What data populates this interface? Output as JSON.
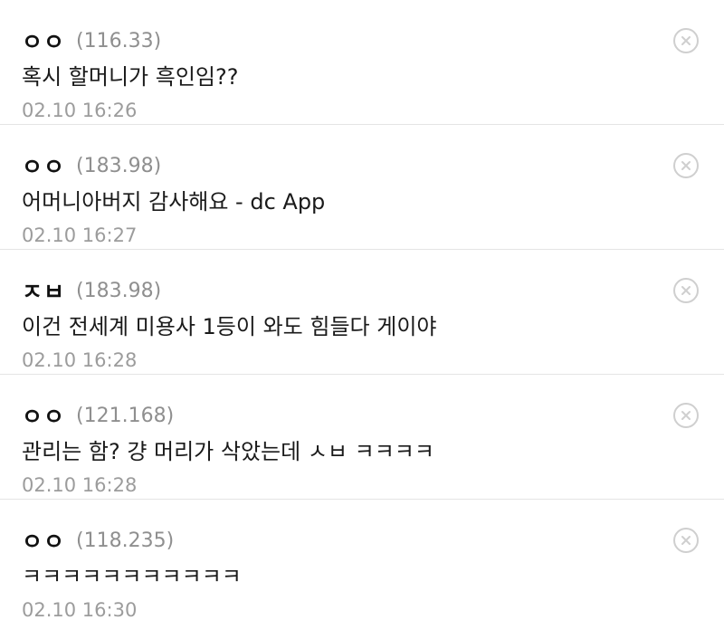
{
  "comments": [
    {
      "nickname": "ㅇㅇ",
      "ip": "(116.33)",
      "text": "혹시 할머니가 흑인임??",
      "time": "02.10 16:26"
    },
    {
      "nickname": "ㅇㅇ",
      "ip": "(183.98)",
      "text": "어머니아버지 감사해요 - dc App",
      "time": "02.10 16:27"
    },
    {
      "nickname": "ㅈㅂ",
      "ip": "(183.98)",
      "text": "이건 전세계 미용사 1등이 와도 힘들다 게이야",
      "time": "02.10 16:28"
    },
    {
      "nickname": "ㅇㅇ",
      "ip": "(121.168)",
      "text": "관리는 함? 걍 머리가 삭았는데 ㅅㅂ ㅋㅋㅋㅋ",
      "time": "02.10 16:28"
    },
    {
      "nickname": "ㅇㅇ",
      "ip": "(118.235)",
      "text": "ㅋㅋㅋㅋㅋㅋㅋㅋㅋㅋㅋ",
      "time": "02.10 16:30"
    }
  ],
  "icons": {
    "delete": "close-circle-icon"
  },
  "colors": {
    "text": "#1a1a1a",
    "meta": "#8f8f8f",
    "divider": "#e4e4e4",
    "icon": "#cfcfcf"
  }
}
